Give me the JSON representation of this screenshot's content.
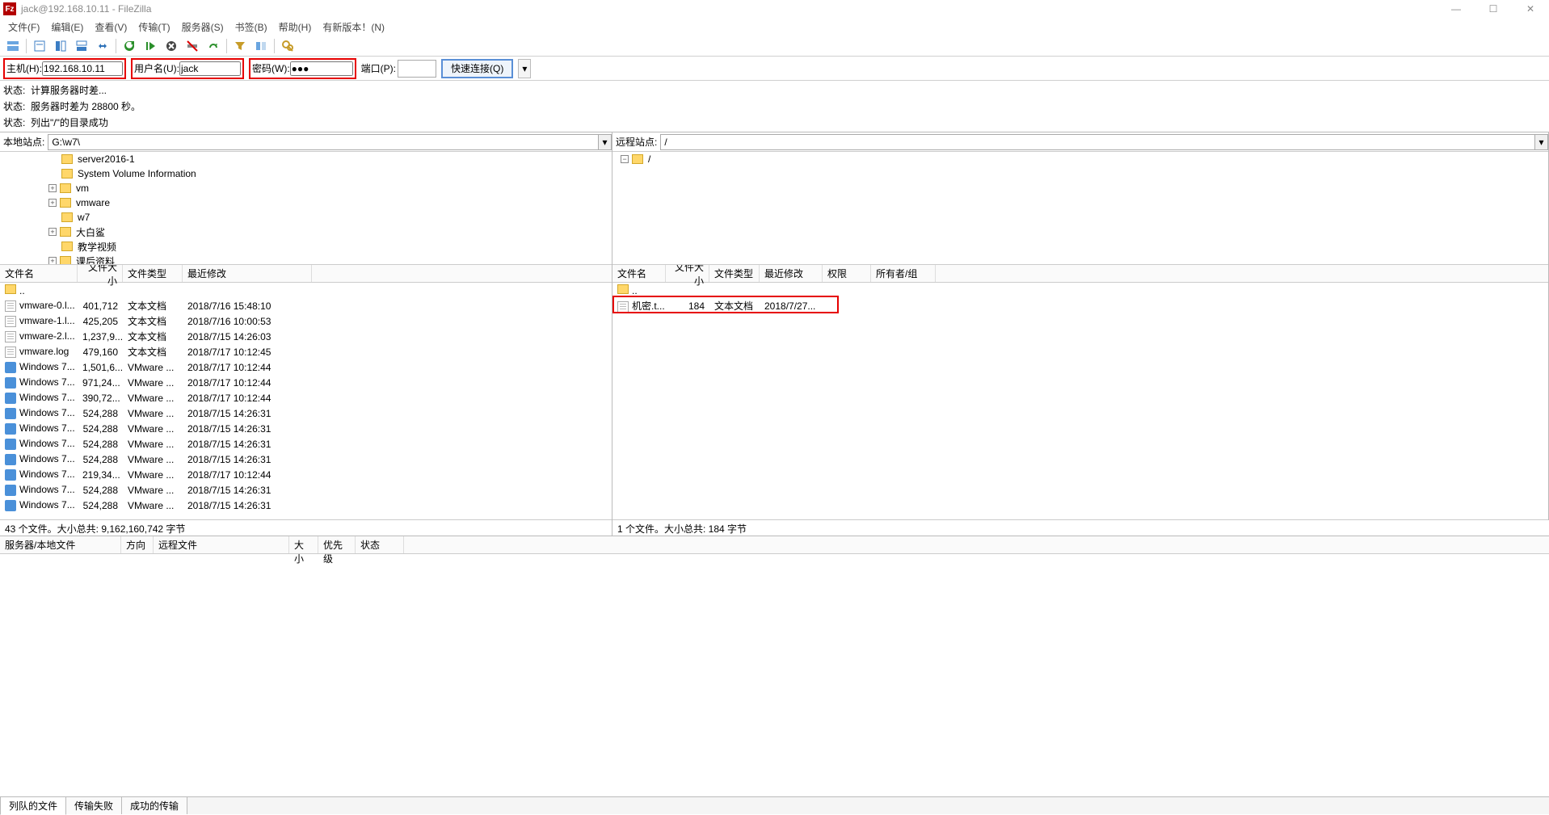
{
  "window": {
    "title": "jack@192.168.10.11 - FileZilla"
  },
  "menu": {
    "file": "文件(F)",
    "edit": "编辑(E)",
    "view": "查看(V)",
    "transfer": "传输(T)",
    "server": "服务器(S)",
    "bookmarks": "书签(B)",
    "help": "帮助(H)",
    "newver": "有新版本！(N)"
  },
  "quickconnect": {
    "host_label": "主机(H):",
    "host_value": "192.168.10.11",
    "user_label": "用户名(U):",
    "user_value": "jack",
    "pass_label": "密码(W):",
    "pass_value": "●●●",
    "port_label": "端口(P):",
    "port_value": "",
    "button": "快速连接(Q)"
  },
  "log": {
    "l1": "状态:  计算服务器时差...",
    "l2": "状态:  服务器时差为 28800 秒。",
    "l3": "状态:  列出\"/\"的目录成功"
  },
  "local": {
    "label": "本地站点:",
    "path": "G:\\w7\\",
    "tree": [
      "server2016-1",
      "System Volume Information",
      "vm",
      "vmware",
      "w7",
      "大白鲨",
      "教学视频",
      "课后资料"
    ],
    "tree_expandable": [
      false,
      false,
      true,
      true,
      false,
      true,
      false,
      true
    ],
    "cols": {
      "name": "文件名",
      "size": "文件大小",
      "type": "文件类型",
      "mod": "最近修改"
    },
    "parent": "..",
    "rows": [
      {
        "n": "vmware-0.l...",
        "s": "401,712",
        "t": "文本文档",
        "m": "2018/7/16 15:48:10",
        "i": "doc"
      },
      {
        "n": "vmware-1.l...",
        "s": "425,205",
        "t": "文本文档",
        "m": "2018/7/16 10:00:53",
        "i": "doc"
      },
      {
        "n": "vmware-2.l...",
        "s": "1,237,9...",
        "t": "文本文档",
        "m": "2018/7/15 14:26:03",
        "i": "doc"
      },
      {
        "n": "vmware.log",
        "s": "479,160",
        "t": "文本文档",
        "m": "2018/7/17 10:12:45",
        "i": "doc"
      },
      {
        "n": "Windows 7...",
        "s": "1,501,6...",
        "t": "VMware ...",
        "m": "2018/7/17 10:12:44",
        "i": "vm"
      },
      {
        "n": "Windows 7...",
        "s": "971,24...",
        "t": "VMware ...",
        "m": "2018/7/17 10:12:44",
        "i": "vm"
      },
      {
        "n": "Windows 7...",
        "s": "390,72...",
        "t": "VMware ...",
        "m": "2018/7/17 10:12:44",
        "i": "vm"
      },
      {
        "n": "Windows 7...",
        "s": "524,288",
        "t": "VMware ...",
        "m": "2018/7/15 14:26:31",
        "i": "vm"
      },
      {
        "n": "Windows 7...",
        "s": "524,288",
        "t": "VMware ...",
        "m": "2018/7/15 14:26:31",
        "i": "vm"
      },
      {
        "n": "Windows 7...",
        "s": "524,288",
        "t": "VMware ...",
        "m": "2018/7/15 14:26:31",
        "i": "vm"
      },
      {
        "n": "Windows 7...",
        "s": "524,288",
        "t": "VMware ...",
        "m": "2018/7/15 14:26:31",
        "i": "vm"
      },
      {
        "n": "Windows 7...",
        "s": "219,34...",
        "t": "VMware ...",
        "m": "2018/7/17 10:12:44",
        "i": "vm"
      },
      {
        "n": "Windows 7...",
        "s": "524,288",
        "t": "VMware ...",
        "m": "2018/7/15 14:26:31",
        "i": "vm"
      },
      {
        "n": "Windows 7...",
        "s": "524,288",
        "t": "VMware ...",
        "m": "2018/7/15 14:26:31",
        "i": "vm"
      }
    ],
    "status": "43 个文件。大小总共: 9,162,160,742 字节"
  },
  "remote": {
    "label": "远程站点:",
    "path": "/",
    "tree_root": "/",
    "cols": {
      "name": "文件名",
      "size": "文件大小",
      "type": "文件类型",
      "mod": "最近修改",
      "perm": "权限",
      "own": "所有者/组"
    },
    "parent": "..",
    "rows": [
      {
        "n": "机密.t...",
        "s": "184",
        "t": "文本文档",
        "m": "2018/7/27...",
        "i": "doc"
      }
    ],
    "status": "1 个文件。大小总共: 184 字节"
  },
  "queue": {
    "cols": {
      "srv": "服务器/本地文件",
      "dir": "方向",
      "rem": "远程文件",
      "size": "大小",
      "prio": "优先级",
      "stat": "状态"
    }
  },
  "tabs": {
    "queued": "列队的文件",
    "failed": "传输失败",
    "success": "成功的传输"
  }
}
